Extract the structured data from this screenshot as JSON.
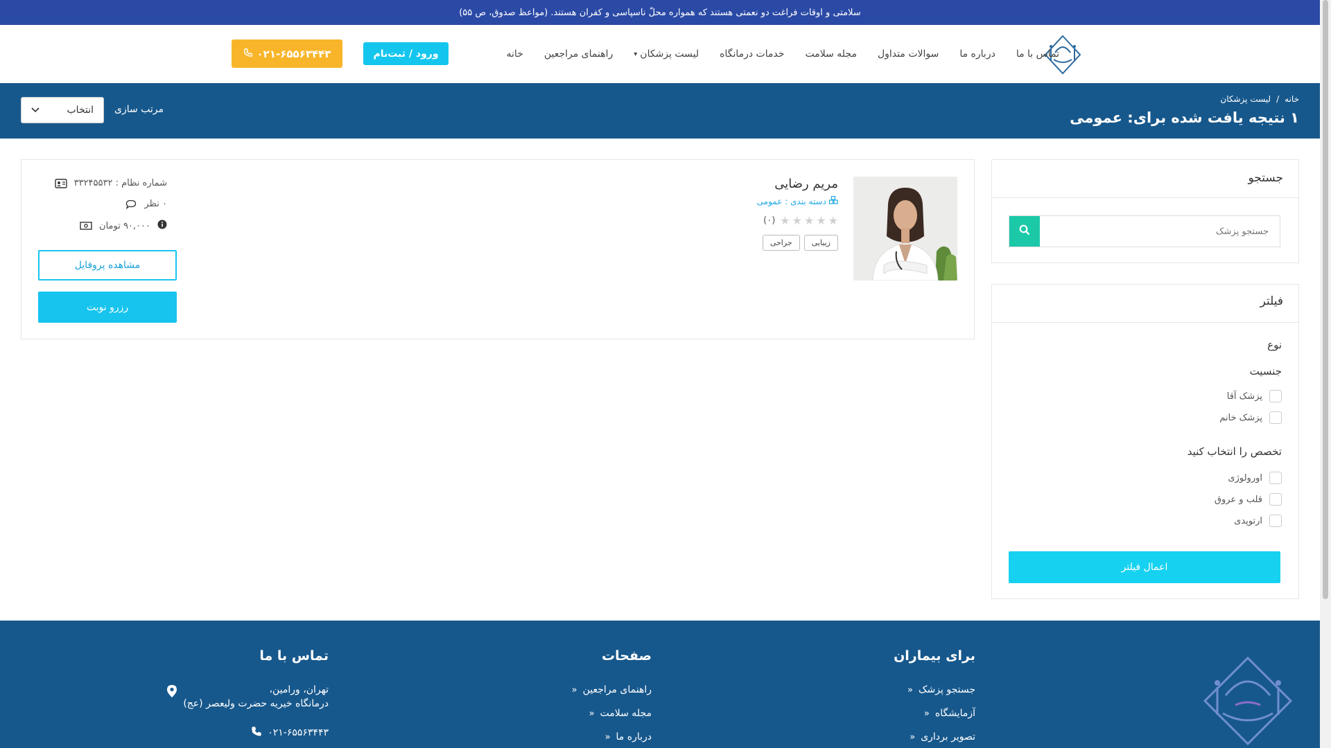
{
  "topbar": {
    "text": "سلامتی و اوقات فراغت دو نعمتی هستند که همواره محلّ ناسپاسی و کفران هستند. (مواعظ صدوق، ص ۵۵)"
  },
  "nav": {
    "items": [
      "خانه",
      "راهنمای مراجعین",
      "لیست پزشکان",
      "خدمات درمانگاه",
      "مجله سلامت",
      "سوالات متداول",
      "درباره ما",
      "تماس با ما"
    ],
    "login_label": "ورود / ثبت‌نام",
    "phone_label": "۰۲۱-۶۵۵۶۳۴۴۳"
  },
  "band": {
    "breadcrumb": [
      "خانه",
      "/",
      "لیست پزشکان"
    ],
    "title": "۱ نتیجه یافت شده برای: عمومی",
    "sort_label": "مرتب سازی",
    "sort_value": "انتخاب"
  },
  "search_panel": {
    "title": "جستجو",
    "placeholder": "جستجو پزشک"
  },
  "filter_panel": {
    "title": "فیلتر",
    "type_heading": "نوع",
    "gender_heading": "جنسیت",
    "gender_options": [
      "پزشک آقا",
      "پزشک خانم"
    ],
    "specialty_heading": "تخصص را انتخاب کنید",
    "specialty_options": [
      "اورولوژی",
      "قلب و عروق",
      "ارتوپدی"
    ],
    "apply_label": "اعمال فیلتر"
  },
  "doctor": {
    "name": "مریم رضایی",
    "category": "دسته بندی : عمومی",
    "rating": 0,
    "rating_max": 5,
    "rating_count": "(۰)",
    "tags": [
      "زیبایی",
      "جراحی"
    ],
    "system_number": "شماره نظام : ۳۳۲۴۵۵۳۲",
    "comments": "۰ نظر",
    "fee": "۹۰,۰۰۰ تومان",
    "profile_label": "مشاهده پروفایل",
    "reserve_label": "رزرو نوبت"
  },
  "footer": {
    "patients_title": "برای بیماران",
    "patients_links": [
      "جستجو پزشک",
      "آزمایشگاه",
      "تصویر برداری"
    ],
    "pages_title": "صفحات",
    "pages_links": [
      "راهنمای مراجعین",
      "مجله سلامت",
      "درباره ما"
    ],
    "contact_title": "تماس با ما",
    "address_line1": "تهران، ورامین،",
    "address_line2": "درمانگاه خیریه حضرت ولیعصر (عج)",
    "phone": "۰۲۱-۶۵۵۶۳۴۴۳"
  },
  "colors": {
    "topbar": "#2b4aa6",
    "band": "#17588c",
    "accent": "#16c4ee",
    "phone_button": "#f9b52a",
    "search_button": "#1bc9a9"
  }
}
